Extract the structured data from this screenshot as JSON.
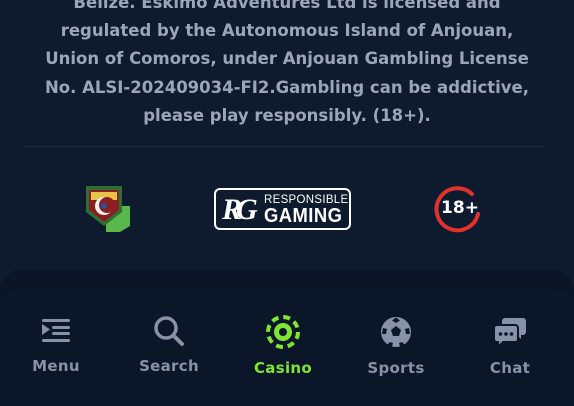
{
  "license": {
    "lines": [
      "Belize. Eskimo Adventures Ltd is licensed and",
      "regulated by the Autonomous Island of Anjouan,",
      "Union of Comoros, under Anjouan Gambling License",
      "No. ALSI-202409034-FI2.Gambling can be addictive,",
      "please play responsibly. (18+)."
    ]
  },
  "badges": {
    "responsible_gaming": {
      "logo": "RG",
      "top": "RESPONSIBLE",
      "bottom": "GAMING"
    },
    "age": {
      "text": "18+"
    }
  },
  "nav": {
    "active": "casino",
    "items": [
      {
        "id": "menu",
        "label": "Menu",
        "icon": "menu-icon"
      },
      {
        "id": "search",
        "label": "Search",
        "icon": "search-icon"
      },
      {
        "id": "casino",
        "label": "Casino",
        "icon": "casino-chip-icon"
      },
      {
        "id": "sports",
        "label": "Sports",
        "icon": "soccer-ball-icon"
      },
      {
        "id": "chat",
        "label": "Chat",
        "icon": "chat-icon"
      }
    ]
  },
  "colors": {
    "background": "#0e1a2e",
    "navbar": "#0b1628",
    "text_muted": "#9aa6b8",
    "nav_inactive": "#8592a8",
    "accent": "#7fe532",
    "age_red": "#e0312b"
  }
}
